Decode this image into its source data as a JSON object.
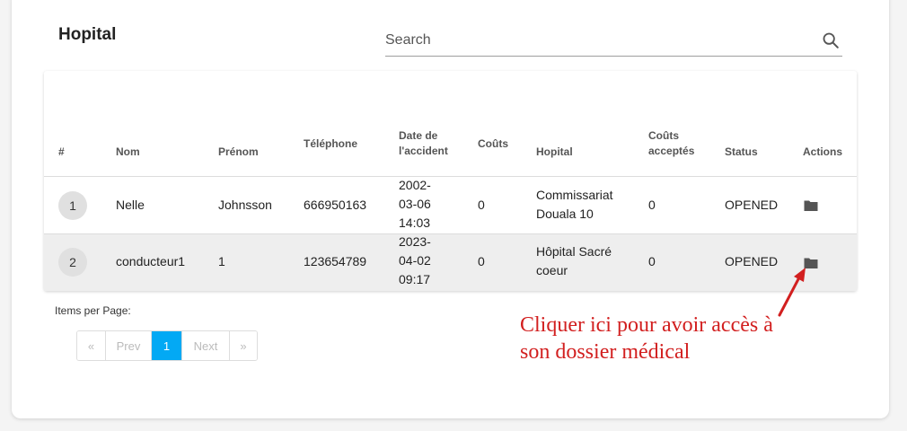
{
  "page": {
    "title": "Hopital"
  },
  "search": {
    "placeholder": "Search",
    "value": ""
  },
  "table": {
    "headers": {
      "num": "#",
      "nom": "Nom",
      "prenom": "Prénom",
      "telephone": "Téléphone",
      "date_line1": "Date de",
      "date_line2": "l'accident",
      "couts": "Coûts",
      "hopital": "Hopital",
      "couts_acc_line1": "Coûts",
      "couts_acc_line2": "acceptés",
      "status": "Status",
      "actions": "Actions"
    },
    "rows": [
      {
        "num": "1",
        "nom": "Nelle",
        "prenom": "Johnsson",
        "telephone": "666950163",
        "date_l1": "2002-",
        "date_l2": "03-06",
        "date_l3": "14:03",
        "couts": "0",
        "hopital_l1": "Commissariat",
        "hopital_l2": "Douala 10",
        "couts_acceptes": "0",
        "status": "OPENED",
        "action_icon": "folder-icon"
      },
      {
        "num": "2",
        "nom": "conducteur1",
        "prenom": "1",
        "telephone": "123654789",
        "date_l1": "2023-",
        "date_l2": "04-02",
        "date_l3": "09:17",
        "couts": "0",
        "hopital_l1": "Hôpital Sacré",
        "hopital_l2": "coeur",
        "couts_acceptes": "0",
        "status": "OPENED",
        "action_icon": "folder-icon"
      }
    ]
  },
  "pagination": {
    "items_per_page_label": "Items per Page:",
    "first": "«",
    "prev": "Prev",
    "current": "1",
    "next": "Next",
    "last": "»"
  },
  "annotation": {
    "line1": "Cliquer ici pour avoir accès à",
    "line2": "son dossier médical",
    "color": "#d21f1f"
  },
  "colors": {
    "accent": "#03a9f4",
    "icon": "#555555"
  }
}
